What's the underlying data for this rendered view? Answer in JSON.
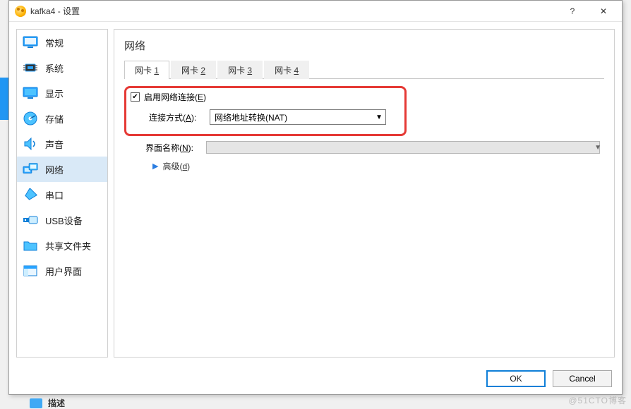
{
  "title": "kafka4 - 设置",
  "sidebar": {
    "items": [
      {
        "label": "常规"
      },
      {
        "label": "系统"
      },
      {
        "label": "显示"
      },
      {
        "label": "存储"
      },
      {
        "label": "声音"
      },
      {
        "label": "网络"
      },
      {
        "label": "串口"
      },
      {
        "label": "USB设备"
      },
      {
        "label": "共享文件夹"
      },
      {
        "label": "用户界面"
      }
    ],
    "selectedIndex": 5
  },
  "content": {
    "heading": "网络",
    "tabs": [
      "网卡 1",
      "网卡 2",
      "网卡 3",
      "网卡 4"
    ],
    "activeTab": 0,
    "enable": {
      "label_prefix": "启用网络连接(",
      "hotkey": "E",
      "label_suffix": ")",
      "checked": true
    },
    "attach": {
      "label_prefix": "连接方式(",
      "hotkey": "A",
      "label_suffix": "):",
      "value": "网络地址转换(NAT)"
    },
    "iface": {
      "label_prefix": "界面名称(",
      "hotkey": "N",
      "label_suffix": "):",
      "value": ""
    },
    "advanced": {
      "label_prefix": "高级(",
      "hotkey": "d",
      "label_suffix": ")"
    }
  },
  "buttons": {
    "ok": "OK",
    "cancel": "Cancel"
  },
  "desc_label": "描述",
  "watermark": "@51CTO博客"
}
